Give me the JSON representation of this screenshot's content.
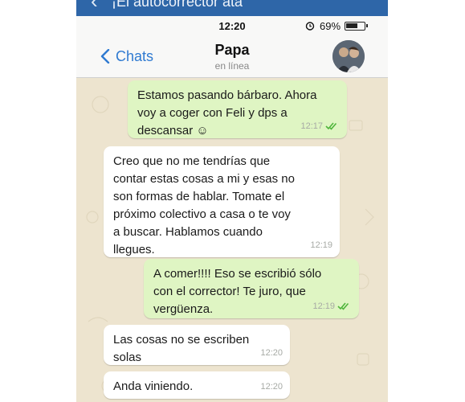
{
  "banner": {
    "text": "¡El autocorrector ata"
  },
  "status_bar": {
    "time": "12:20",
    "battery": "69%"
  },
  "nav": {
    "back_label": "Chats",
    "contact_name": "Papa",
    "contact_status": "en línea"
  },
  "messages": [
    {
      "direction": "outgoing",
      "lines": [
        "Estamos pasando bárbaro. Ahora",
        "voy a coger con Feli y dps a",
        "descansar ☺"
      ],
      "time": "12:17",
      "read": true
    },
    {
      "direction": "incoming",
      "lines": [
        "Creo que no me tendrías que",
        "contar estas cosas a mi y esas no",
        "son formas de hablar. Tomate el",
        "próximo colectivo a casa o te voy",
        "a buscar. Hablamos cuando",
        "llegues."
      ],
      "time": "12:19"
    },
    {
      "direction": "outgoing",
      "lines": [
        "A comer!!!! Eso se escribió sólo",
        "con el corrector! Te juro, que",
        "vergüenza."
      ],
      "time": "12:19",
      "read": true
    },
    {
      "direction": "incoming",
      "lines": [
        "Las cosas no se escriben",
        "solas"
      ],
      "time": "12:20"
    },
    {
      "direction": "incoming",
      "lines": [
        "Anda viniendo."
      ],
      "time": "12:20"
    }
  ],
  "colors": {
    "outgoing_bubble": "#dff5c3",
    "incoming_bubble": "#ffffff",
    "accent": "#2f7ad1",
    "read_ticks": "#4fb53b",
    "wallpaper": "#ede4cf"
  }
}
